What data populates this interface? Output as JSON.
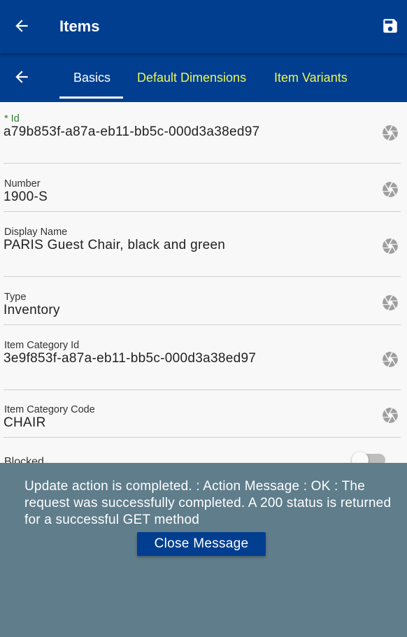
{
  "app_bar": {
    "title": "Items",
    "back_icon": "arrow-left-icon",
    "save_icon": "floppy-disk-icon"
  },
  "tabs": [
    {
      "label": "Basics",
      "active": true
    },
    {
      "label": "Default Dimensions",
      "active": false
    },
    {
      "label": "Item Variants",
      "active": false
    }
  ],
  "fields": [
    {
      "label": "* Id",
      "value": "a79b853f-a87a-eb11-bb5c-000d3a38ed97",
      "icon": "aperture-icon"
    },
    {
      "label": "Number",
      "value": "1900-S",
      "icon": "aperture-icon"
    },
    {
      "label": "Display Name",
      "value": "PARIS Guest Chair, black and green",
      "icon": "aperture-icon"
    },
    {
      "label": "Type",
      "value": "Inventory",
      "icon": "aperture-icon"
    },
    {
      "label": "Item Category Id",
      "value": "3e9f853f-a87a-eb11-bb5c-000d3a38ed97",
      "icon": "aperture-icon"
    },
    {
      "label": "Item Category Code",
      "value": "CHAIR",
      "icon": "aperture-icon"
    },
    {
      "label": "Blocked",
      "toggle_on": false
    }
  ],
  "message": {
    "text": "Update action is completed.  : Action Message : OK : The request was successfully completed. A 200 status is returned for a successful GET method",
    "button_label": "Close Message"
  },
  "colors": {
    "primary": "#013e8f",
    "tab_inactive": "#e9f75a",
    "required_label": "#2e7d32",
    "overlay": "#5f7d8b"
  }
}
